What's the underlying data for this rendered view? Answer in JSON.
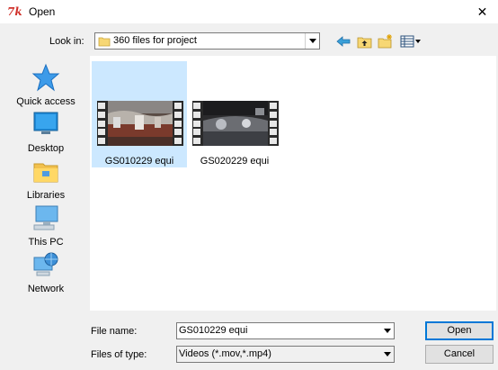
{
  "window": {
    "app_icon_text": "7k",
    "title": "Open",
    "close_glyph": "✕"
  },
  "lookin": {
    "label": "Look in:",
    "value": "360 files for project"
  },
  "toolbar": {
    "icons": [
      "back-arrow-icon",
      "up-folder-icon",
      "new-folder-icon",
      "view-menu-icon"
    ]
  },
  "places": [
    {
      "label": "Quick access",
      "icon": "star-icon"
    },
    {
      "label": "Desktop",
      "icon": "desktop-icon"
    },
    {
      "label": "Libraries",
      "icon": "libraries-icon"
    },
    {
      "label": "This PC",
      "icon": "computer-icon"
    },
    {
      "label": "Network",
      "icon": "network-icon"
    }
  ],
  "files": [
    {
      "name": "GS010229 equi",
      "selected": true
    },
    {
      "name": "GS020229 equi",
      "selected": false
    }
  ],
  "filename": {
    "label": "File name:",
    "value": "GS010229 equi"
  },
  "filetype": {
    "label": "Files of type:",
    "value": "Videos (*.mov,*.mp4)"
  },
  "buttons": {
    "open": "Open",
    "cancel": "Cancel"
  },
  "colors": {
    "selection": "#cce8ff",
    "input_selection": "#0078d7",
    "default_button_border": "#0078d7"
  }
}
